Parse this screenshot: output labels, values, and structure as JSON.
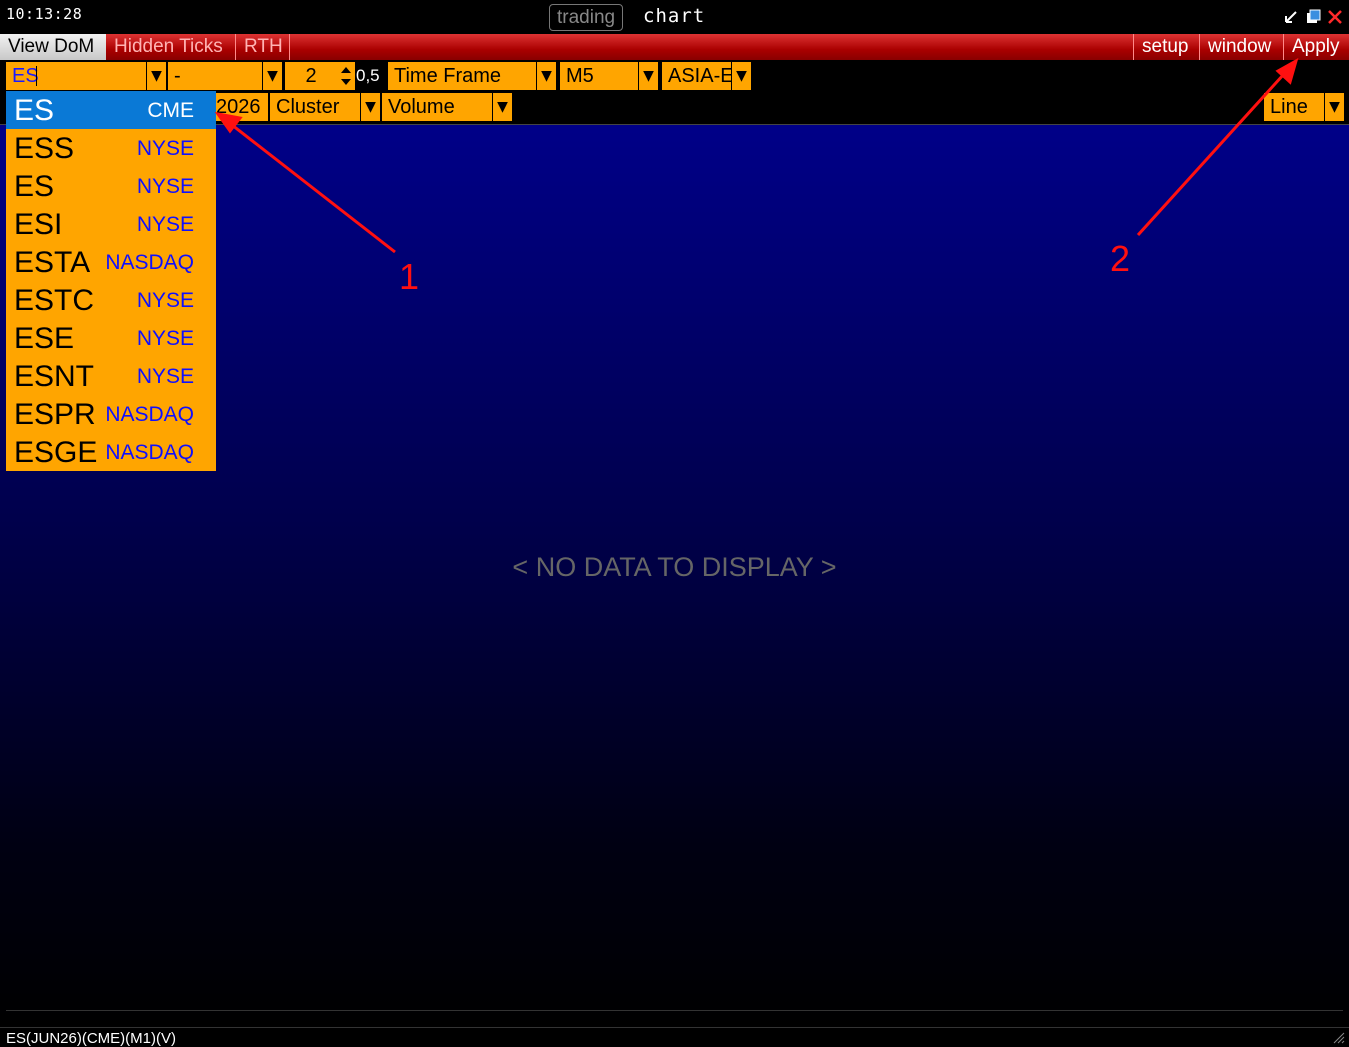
{
  "titlebar": {
    "clock": "10:13:28",
    "app_tag": "trading",
    "window_title": "chart"
  },
  "menubar": {
    "left": [
      "View DoM",
      "Hidden Ticks",
      "RTH"
    ],
    "setup": "setup",
    "window": "window",
    "apply": "Apply"
  },
  "toolbar": {
    "symbol": "ES",
    "contract": "-",
    "multiplier": "2",
    "step": "0,5",
    "timeframe_label": "Time Frame",
    "timeframe_value": "M5",
    "session": "ASIA-E",
    "date_fragment": "2026",
    "chart_style": "Cluster",
    "cluster_mode": "Volume",
    "line_mode": "Line"
  },
  "dropdown": {
    "items": [
      {
        "symbol": "ES",
        "exchange": "CME",
        "selected": true
      },
      {
        "symbol": "ESS",
        "exchange": "NYSE"
      },
      {
        "symbol": "ES",
        "exchange": "NYSE"
      },
      {
        "symbol": "ESI",
        "exchange": "NYSE"
      },
      {
        "symbol": "ESTA",
        "exchange": "NASDAQ"
      },
      {
        "symbol": "ESTC",
        "exchange": "NYSE"
      },
      {
        "symbol": "ESE",
        "exchange": "NYSE"
      },
      {
        "symbol": "ESNT",
        "exchange": "NYSE"
      },
      {
        "symbol": "ESPR",
        "exchange": "NASDAQ"
      },
      {
        "symbol": "ESGE",
        "exchange": "NASDAQ"
      }
    ]
  },
  "chart": {
    "empty_message": "< NO DATA TO DISPLAY >"
  },
  "statusbar": {
    "text": "ES(JUN26)(CME)(M1)(V)"
  },
  "annotations": {
    "label_1": "1",
    "label_2": "2"
  },
  "colors": {
    "accent": "#ffa500",
    "menubar": "#c00000",
    "selection": "#0a79d6",
    "annotation": "#ff1010"
  }
}
